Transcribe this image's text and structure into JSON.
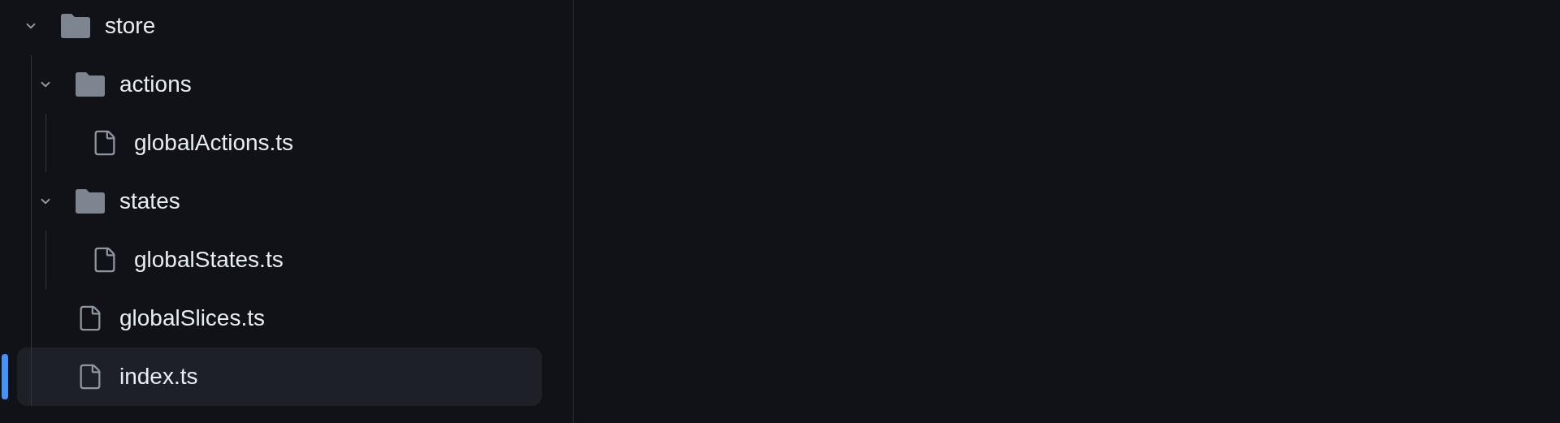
{
  "file_tree": [
    {
      "kind": "folder",
      "name": "store",
      "expanded": true,
      "selected": false,
      "children": [
        {
          "kind": "folder",
          "name": "actions",
          "expanded": true,
          "selected": false,
          "children": [
            {
              "kind": "file",
              "name": "globalActions.ts",
              "selected": false
            }
          ]
        },
        {
          "kind": "folder",
          "name": "states",
          "expanded": true,
          "selected": false,
          "children": [
            {
              "kind": "file",
              "name": "globalStates.ts",
              "selected": false
            }
          ]
        },
        {
          "kind": "file",
          "name": "globalSlices.ts",
          "selected": false
        },
        {
          "kind": "file",
          "name": "index.ts",
          "selected": true
        }
      ]
    }
  ]
}
